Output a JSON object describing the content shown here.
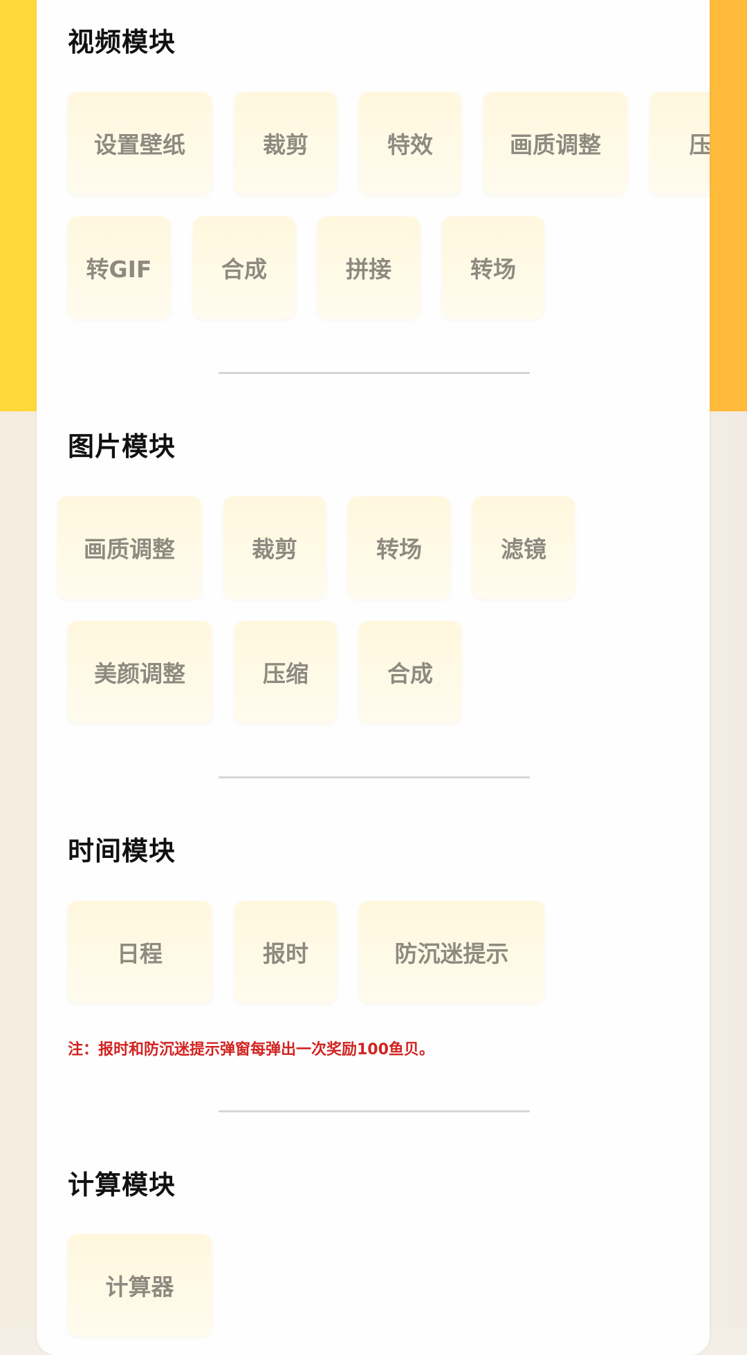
{
  "sections": {
    "video": {
      "title": "视频模块",
      "items": [
        "设置壁纸",
        "裁剪",
        "特效",
        "画质调整",
        "压",
        "转GIF",
        "合成",
        "拼接",
        "转场"
      ]
    },
    "image": {
      "title": "图片模块",
      "items": [
        "画质调整",
        "裁剪",
        "转场",
        "滤镜",
        "美颜调整",
        "压缩",
        "合成"
      ]
    },
    "time": {
      "title": "时间模块",
      "items": [
        "日程",
        "报时",
        "防沉迷提示"
      ],
      "note": "注：报时和防沉迷提示弹窗每弹出一次奖励100鱼贝。"
    },
    "calc": {
      "title": "计算模块",
      "items": [
        "计算器"
      ]
    }
  },
  "colors": {
    "header_gradient": [
      "#ffd93a",
      "#ffb93b"
    ],
    "tile_bg": "#fff8de",
    "tile_text": "#8f8a80",
    "note_text": "#d12320"
  }
}
